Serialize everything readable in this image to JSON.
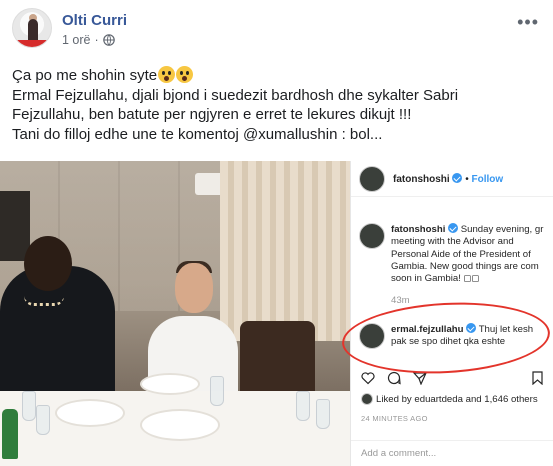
{
  "post": {
    "author": "Olti Curri",
    "time": "1 orë",
    "dot": "·",
    "more": "•••",
    "text_lines": [
      "Ça po me shohin syte",
      "Ermal Fejzullahu, djali bjond i suedezit bardhosh dhe sykalter Sabri",
      "Fejzullahu, ben batute per ngjyren e erret te lekures dikujt !!!",
      "Tani do filloj edhe une te komentoj @xumallushin : bol..."
    ]
  },
  "instagram": {
    "header_user": "fatonshoshi",
    "header_dot": "•",
    "follow": "Follow",
    "caption_user": "fatonshoshi",
    "caption_text": "Sunday evening, gr meeting with the Advisor and Personal Aide of the President of Gambia. New good things are com soon in Gambia! ◻◻",
    "time": "43m",
    "comment_user": "ermal.fejzullahu",
    "comment_text": "Thuj let kesh pak se spo dihet qka eshte",
    "likes": "Liked by eduartdeda and 1,646 others",
    "ago": "24 MINUTES AGO",
    "add_comment": "Add a comment..."
  },
  "colors": {
    "author_link": "#385898",
    "ig_follow": "#3897f0",
    "annotation": "#e3342b"
  },
  "icons": [
    "globe-icon",
    "more-icon",
    "verified-icon",
    "heart-icon",
    "comment-icon",
    "share-icon",
    "bookmark-icon",
    "face-screaming-emoji"
  ]
}
